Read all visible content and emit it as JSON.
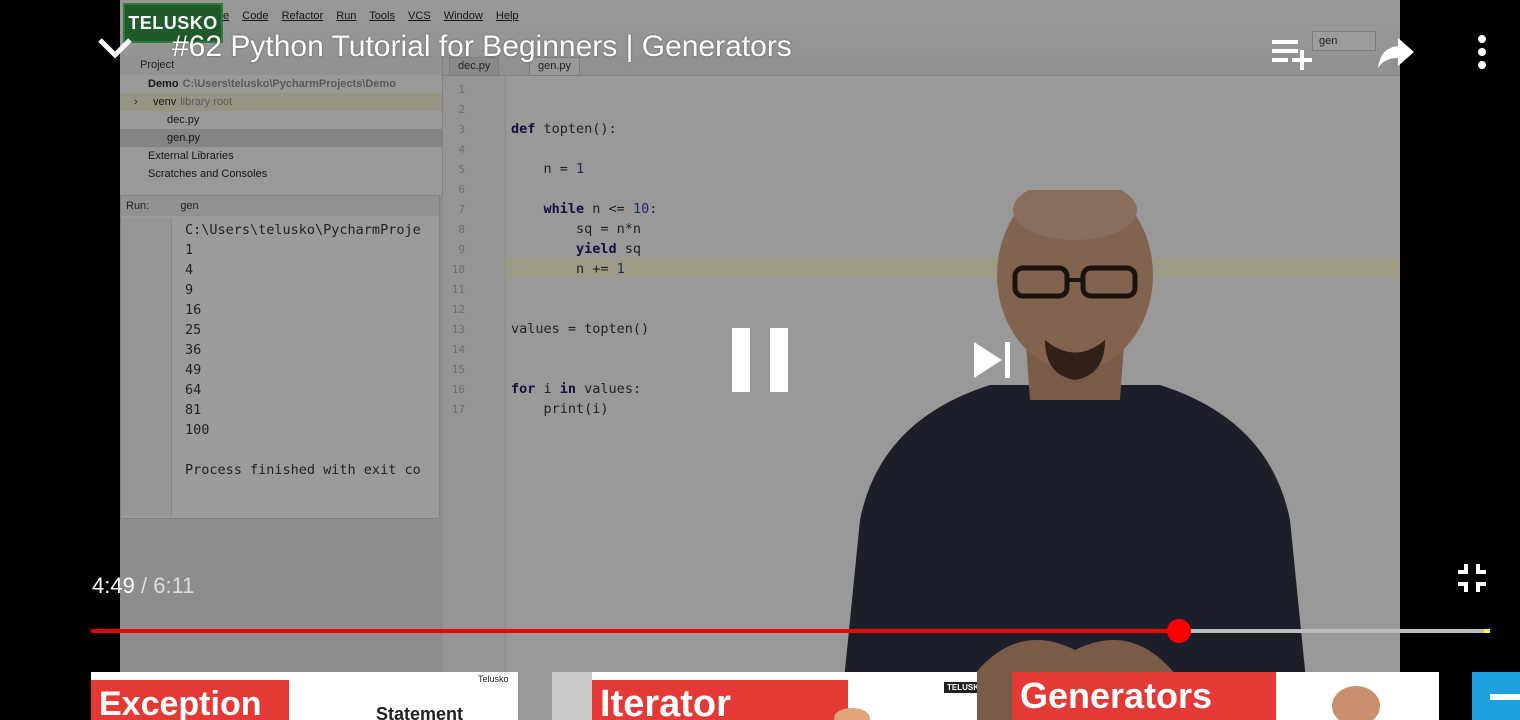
{
  "video": {
    "title": "#62 Python Tutorial for Beginners | Generators",
    "time_current": "4:49",
    "time_separator": "/",
    "time_duration": "6:11",
    "progress_fraction": 0.779,
    "marker_fraction": 0.997,
    "accent_color": "#ff0000"
  },
  "ide": {
    "brand": "TELUSKO",
    "menus": [
      "te",
      "Code",
      "Refactor",
      "Run",
      "Tools",
      "VCS",
      "Window",
      "Help"
    ],
    "run_config": "gen",
    "project_header": "Project",
    "tree": [
      {
        "label": "Demo",
        "muted": "C:\\Users\\telusko\\PycharmProjects\\Demo"
      },
      {
        "label": "venv",
        "muted": "library root"
      },
      {
        "label": "dec.py",
        "muted": ""
      },
      {
        "label": "gen.py",
        "muted": ""
      },
      {
        "label": "External Libraries",
        "muted": ""
      },
      {
        "label": "Scratches and Consoles",
        "muted": ""
      }
    ],
    "run_label": "Run:",
    "run_tab": "gen",
    "run_output": "C:\\Users\\telusko\\PycharmProje\n1\n4\n9\n16\n25\n36\n49\n64\n81\n100\n\nProcess finished with exit co",
    "editor_tabs": [
      "dec.py",
      "gen.py"
    ],
    "line_numbers": [
      "1",
      "2",
      "3",
      "4",
      "5",
      "6",
      "7",
      "8",
      "9",
      "10",
      "11",
      "12",
      "13",
      "14",
      "15",
      "16",
      "17"
    ],
    "code": {
      "l3_kw": "def",
      "l3_rest": " topten():",
      "l5_a": "    n = ",
      "l5_num": "1",
      "l7_kw": "    while",
      "l7_rest": " n <= ",
      "l7_num": "10",
      "l7_end": ":",
      "l8": "        sq = n*n",
      "l9_kw": "        yield",
      "l9_rest": " sq",
      "l10_a": "        n += ",
      "l10_num": "1",
      "l13": "values = topten()",
      "l16_kw": "for",
      "l16_mid": " i ",
      "l16_kw2": "in",
      "l16_rest": " values:",
      "l17": "    print(i)"
    }
  },
  "thumbnails": [
    {
      "label": "Exception",
      "sub": "Statement",
      "corner": "Telusko"
    },
    {
      "label": "Iterator",
      "sub": "",
      "corner": "TELUSKO"
    },
    {
      "label": "Generators",
      "sub": "",
      "corner": ""
    }
  ],
  "icons": [
    "chevron-down-icon",
    "add-to-queue-icon",
    "share-icon",
    "more-vert-icon",
    "previous-icon",
    "pause-icon",
    "next-icon",
    "exit-fullscreen-icon"
  ]
}
